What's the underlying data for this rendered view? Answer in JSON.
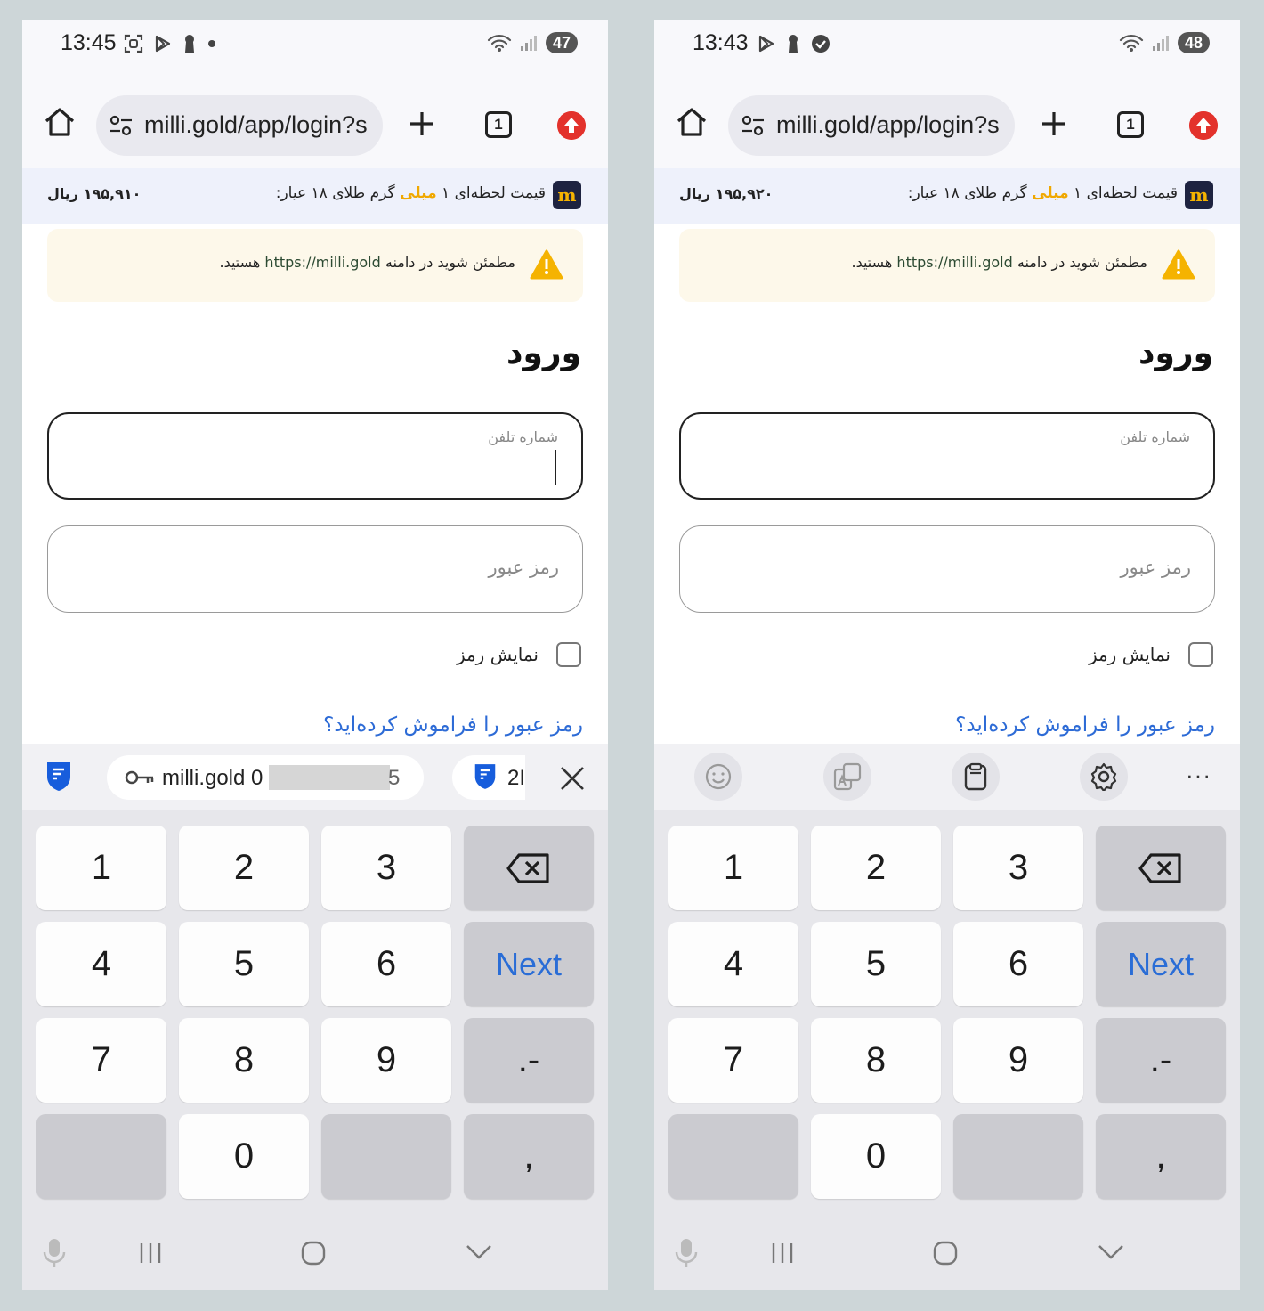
{
  "screens": [
    {
      "status": {
        "time": "13:45",
        "battery": "47"
      },
      "browser": {
        "url": "milli.gold/app/login?s",
        "tab_count": "1"
      },
      "price": {
        "label_pre": "قیمت لحظه‌ای ۱ ",
        "label_gold": "میلی",
        "label_post": " گرم طلای ۱۸ عیار:",
        "value": "۱۹۵,۹۱۰ ریال"
      },
      "warning": {
        "pre": "مطمئن شوید در دامنه ",
        "url": "https://milli.gold",
        "post": " هستید."
      },
      "login": {
        "title": "ورود",
        "phone_label": "شماره تلفن",
        "password_placeholder": "رمز عبور",
        "show_password": "نمایش رمز",
        "forgot": "رمز عبور را فراموش کرده‌اید؟"
      },
      "suggestion": {
        "chip_text": "milli.gold 0",
        "chip_end": "5",
        "chip2_text": "2I"
      },
      "keyboard": {
        "keys": [
          "1",
          "2",
          "3",
          "4",
          "5",
          "6",
          "Next",
          "7",
          "8",
          "9",
          ".-",
          "0",
          ","
        ]
      }
    },
    {
      "status": {
        "time": "13:43",
        "battery": "48"
      },
      "browser": {
        "url": "milli.gold/app/login?s",
        "tab_count": "1"
      },
      "price": {
        "label_pre": "قیمت لحظه‌ای ۱ ",
        "label_gold": "میلی",
        "label_post": " گرم طلای ۱۸ عیار:",
        "value": "۱۹۵,۹۲۰ ریال"
      },
      "warning": {
        "pre": "مطمئن شوید در دامنه ",
        "url": "https://milli.gold",
        "post": " هستید."
      },
      "login": {
        "title": "ورود",
        "phone_label": "شماره تلفن",
        "password_placeholder": "رمز عبور",
        "show_password": "نمایش رمز",
        "forgot": "رمز عبور را فراموش کرده‌اید؟"
      },
      "keyboard": {
        "toolbar_more": "···",
        "keys": [
          "1",
          "2",
          "3",
          "4",
          "5",
          "6",
          "Next",
          "7",
          "8",
          "9",
          ".-",
          "0",
          ","
        ]
      }
    }
  ],
  "colors": {
    "accent_blue": "#2d6bd6",
    "gold": "#f0a800",
    "warning_yellow": "#f5b301",
    "update_red": "#e3322c"
  }
}
